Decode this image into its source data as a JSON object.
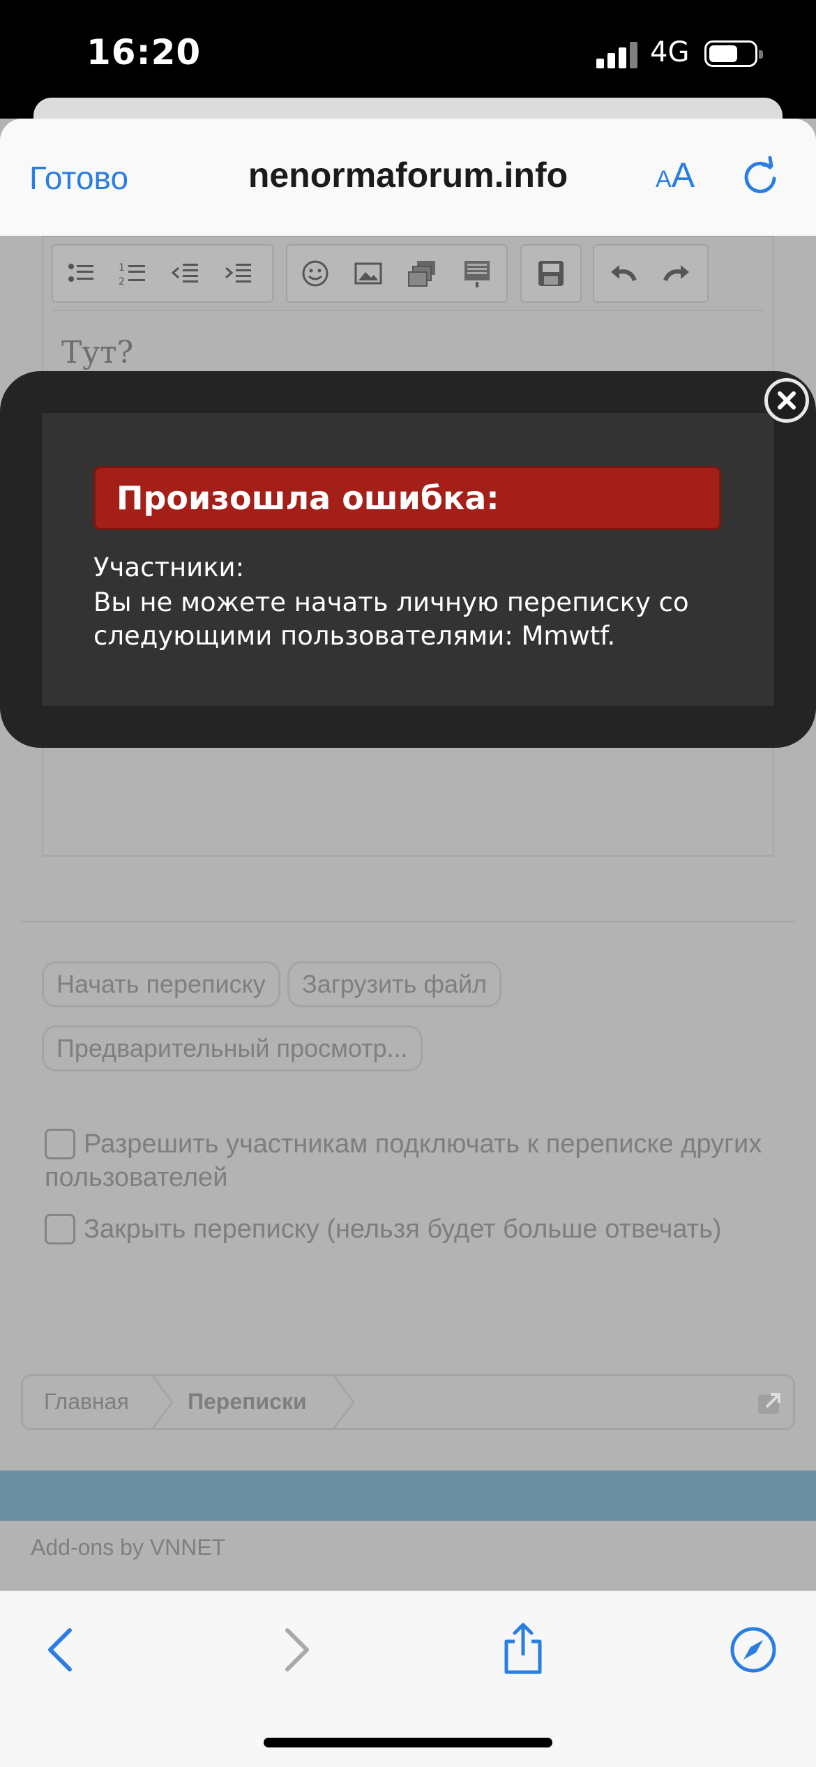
{
  "status_bar": {
    "time": "16:20",
    "network": "4G"
  },
  "browser": {
    "done_label": "Готово",
    "domain": "nenormaforum.info",
    "text_size_small": "A",
    "text_size_large": "A"
  },
  "editor": {
    "body_text": "Тут?"
  },
  "modal": {
    "error_title": "Произошла ошибка:",
    "message_title": "Участники:",
    "message_body": "Вы не можете начать личную переписку со следующими пользователями: Mmwtf."
  },
  "form": {
    "buttons": {
      "start": "Начать переписку",
      "upload": "Загрузить файл",
      "preview": "Предварительный просмотр..."
    },
    "options": {
      "allow_invite": "Разрешить участникам подключать к переписке других пользователей",
      "close_conversation": "Закрыть переписку (нельзя будет больше отвечать)"
    }
  },
  "breadcrumb": {
    "home": "Главная",
    "conversations": "Переписки"
  },
  "footer": {
    "addons": "Add-ons by VNNET"
  },
  "colors": {
    "accent": "#2a7de1",
    "error": "#a31f18",
    "footer_bar": "#6a8fa0"
  }
}
